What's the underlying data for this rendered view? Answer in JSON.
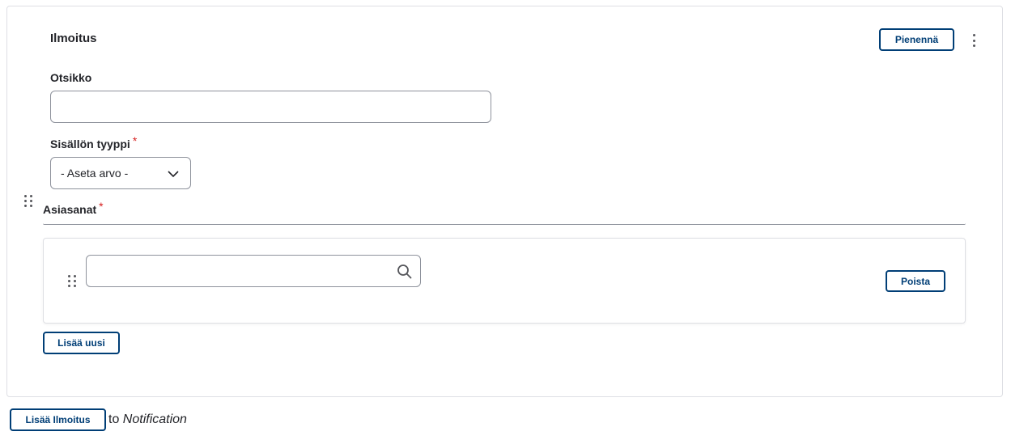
{
  "card": {
    "title": "Ilmoitus",
    "collapse_label": "Pienennä",
    "menu_icon": "kebab-vertical-icon"
  },
  "fields": {
    "title": {
      "label": "Otsikko",
      "value": "",
      "placeholder": ""
    },
    "content_type": {
      "label": "Sisällön tyyppi",
      "required_mark": "*",
      "selected": "- Aseta arvo -"
    },
    "keywords": {
      "label": "Asiasanat",
      "required_mark": "*",
      "items": [
        {
          "value": "",
          "remove_label": "Poista"
        }
      ],
      "add_label": "Lisää uusi"
    }
  },
  "footer": {
    "add_label": "Lisää Ilmoitus",
    "to_text": "to",
    "target": "Notification"
  },
  "colors": {
    "primary": "#003e76",
    "required": "#d72222",
    "border": "#8e929c",
    "card_border": "#dedfe4"
  }
}
